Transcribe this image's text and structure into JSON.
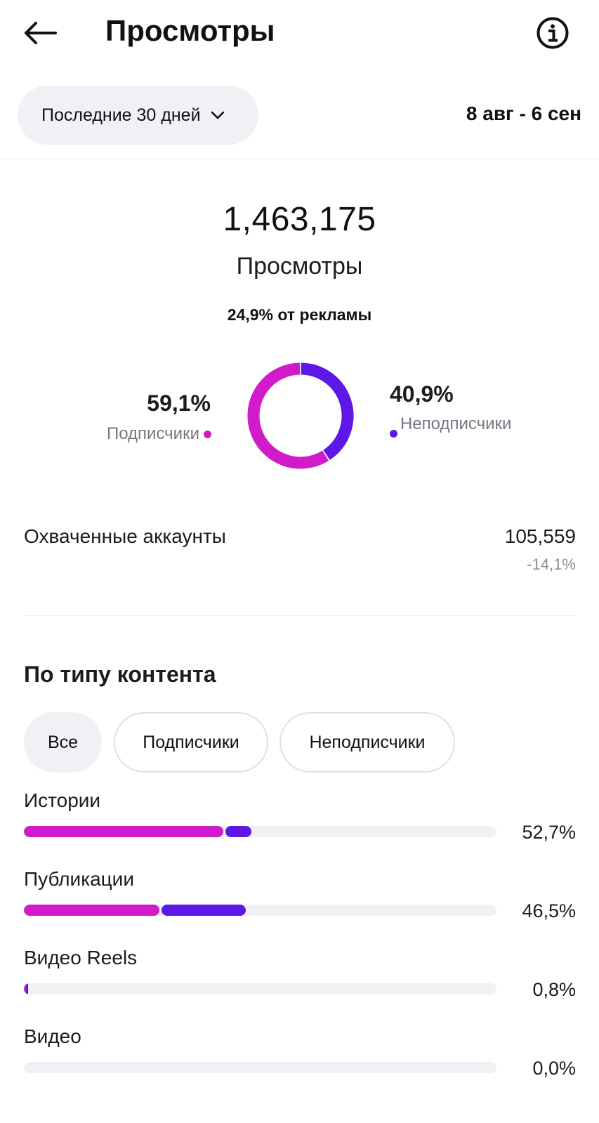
{
  "header": {
    "title": "Просмотры",
    "back_icon": "arrow-left-icon",
    "info_icon": "info-circle-icon"
  },
  "period": {
    "selected": "Последние 30 дней",
    "date_range": "8 авг - 6 сен"
  },
  "summary": {
    "total_views": "1,463,175",
    "total_label": "Просмотры",
    "ads_note": "24,9% от рекламы"
  },
  "audience": {
    "followers_pct": "59,1%",
    "followers_label": "Подписчики",
    "nonfollowers_pct": "40,9%",
    "nonfollowers_label": "Неподписчики",
    "followers_share": 59.1,
    "nonfollowers_share": 40.9
  },
  "reach": {
    "label": "Охваченные аккаунты",
    "value": "105,559",
    "delta": "-14,1%"
  },
  "content_type": {
    "title": "По типу контента",
    "filters": [
      {
        "label": "Все",
        "selected": true
      },
      {
        "label": "Подписчики",
        "selected": false
      },
      {
        "label": "Неподписчики",
        "selected": false
      }
    ],
    "rows": [
      {
        "label": "Истории",
        "percent": "52,7%",
        "followers_share": 42.6,
        "nonfollowers_share": 5.5
      },
      {
        "label": "Публикации",
        "percent": "46,5%",
        "followers_share": 29.1,
        "nonfollowers_share": 17.8
      },
      {
        "label": "Видео Reels",
        "percent": "0,8%",
        "followers_share": 0.5,
        "nonfollowers_share": 0.3
      },
      {
        "label": "Видео",
        "percent": "0,0%",
        "followers_share": 0,
        "nonfollowers_share": 0
      }
    ]
  },
  "colors": {
    "followers": "#d11bcb",
    "nonfollowers": "#5d17e6",
    "track": "#eff1f4"
  }
}
